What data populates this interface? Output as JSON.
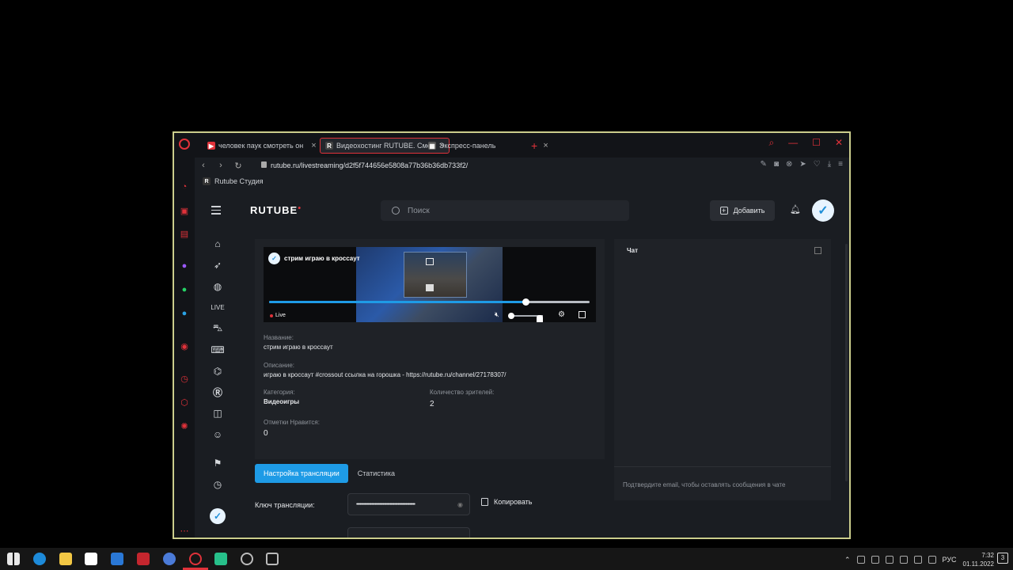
{
  "browser": {
    "tabs": [
      {
        "label": "человек паук смотреть он",
        "close": "×"
      },
      {
        "label": "Видеохостинг RUTUBE. Смо",
        "close": "×"
      },
      {
        "label": "Экспресс-панель",
        "close": "×"
      }
    ],
    "new_tab": "+",
    "url": "rutube.ru/livestreaming/d2f5f744656e5808a77b36b36db733f2/",
    "bookmark": "Rutube Студия",
    "accent": "#e0323a"
  },
  "header": {
    "logo": "RUTUBE",
    "search_placeholder": "Поиск",
    "add_label": "Добавить"
  },
  "player": {
    "title": "стрим играю в кроссаут",
    "live_label": "Live",
    "progress": 0.8,
    "volume": 0.0,
    "accent": "#1e9be6"
  },
  "stream_info": {
    "name_label": "Название:",
    "name_value": "стрим играю в кроссаут",
    "description_label": "Описание:",
    "description_value": "играю в кроссаут #crossout ссылка на горошка - https://rutube.ru/channel/27178307/",
    "category_label": "Категория:",
    "category_value": "Видеоигры",
    "viewers_label": "Количество зрителей:",
    "viewers_value": "2",
    "likes_label": "Отметки Нравится:",
    "likes_value": "0"
  },
  "tabs": {
    "settings": "Настройка трансляции",
    "stats": "Статистика"
  },
  "stream_key": {
    "label": "Ключ трансляции:",
    "masked": "•••••••••••••••••••••••••••••••••••••••••••••••••••",
    "copy_label": "Копировать"
  },
  "chat": {
    "title": "Чат",
    "hint": "Подтвердите email, чтобы оставлять сообщения в чате"
  },
  "taskbar": {
    "lang": "РУС",
    "time": "7:32",
    "date": "01.11.2022",
    "notifications": "3"
  }
}
